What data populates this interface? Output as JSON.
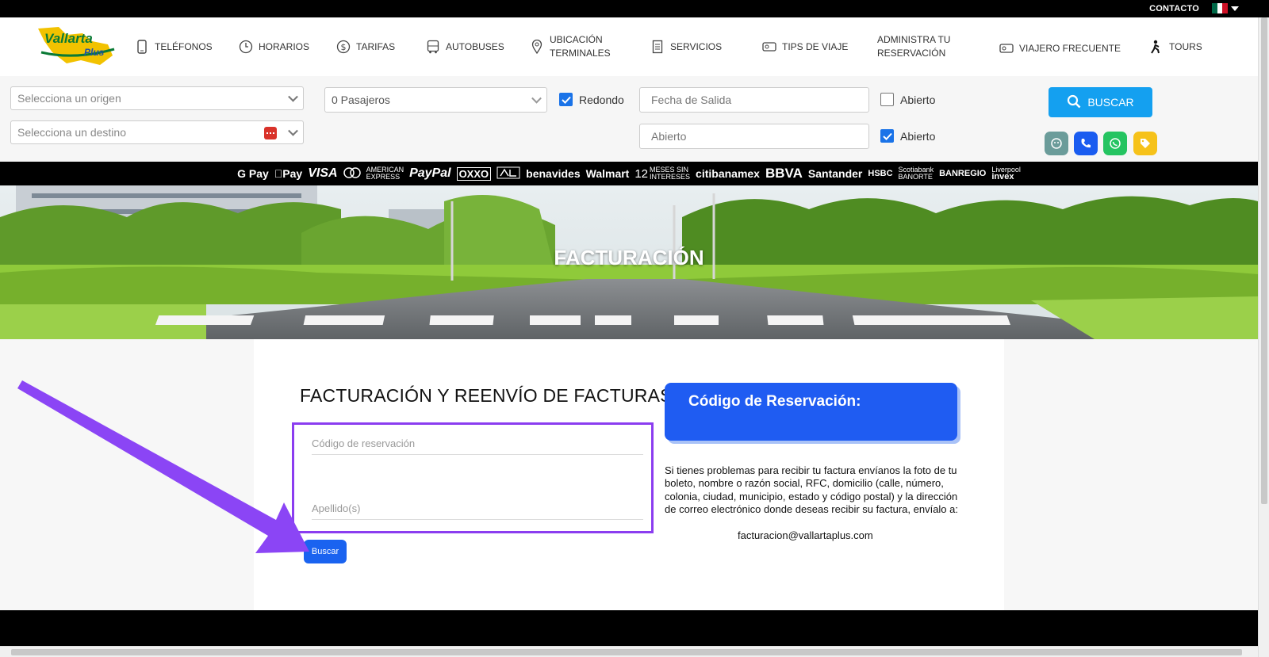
{
  "topbar": {
    "contact": "CONTACTO",
    "flag_colors": [
      "#006847",
      "#ffffff",
      "#ce1126"
    ]
  },
  "brand": {
    "logo_text_1": "Vallarta",
    "logo_text_2": "Plus",
    "logo_yellow": "#f2c200",
    "logo_green": "#0a7a35",
    "logo_blue": "#1e4fa8"
  },
  "nav": {
    "telefonos": "TELÉFONOS",
    "horarios": "HORARIOS",
    "tarifas": "TARIFAS",
    "autobuses": "AUTOBUSES",
    "ubicacion_1": "UBICACIÓN",
    "ubicacion_2": "TERMINALES",
    "servicios": "SERVICIOS",
    "tips": "TIPS DE VIAJE",
    "administra_1": "ADMINISTRA TU",
    "administra_2": "RESERVACIÓN",
    "viajero": "VIAJERO FRECUENTE",
    "tours": "TOURS"
  },
  "search": {
    "origen_placeholder": "Selecciona un origen",
    "destino_placeholder": "Selecciona un destino",
    "pasajeros": "0 Pasajeros",
    "redondo": "Redondo",
    "redondo_checked": true,
    "fecha_salida": "Fecha de Salida",
    "fecha_regreso": "Abierto",
    "abierto_1": "Abierto",
    "abierto_1_checked": false,
    "abierto_2": "Abierto",
    "abierto_2_checked": true,
    "buscar": "BUSCAR",
    "accent": "#14a0f0"
  },
  "quick_buttons": [
    {
      "icon": "chat-bot-icon",
      "color": "#6b9c9a"
    },
    {
      "icon": "phone-icon",
      "color": "#1a5cf0"
    },
    {
      "icon": "whatsapp-icon",
      "color": "#25c461"
    },
    {
      "icon": "tag-icon",
      "color": "#f6c21a"
    }
  ],
  "payments": {
    "gpay": "G Pay",
    "applepay": "Pay",
    "visa": "VISA",
    "amex_1": "AMERICAN",
    "amex_2": "EXPRESS",
    "paypal": "PayPal",
    "oxxo": "OXXO",
    "benavides": "benavides",
    "walmart": "Walmart",
    "meses_num": "12",
    "meses_1": "MESES SIN",
    "meses_2": "INTERESES",
    "citibanamex": "citibanamex",
    "bbva": "BBVA",
    "santander": "Santander",
    "hsbc": "HSBC",
    "scotiabank": "Scotiabank",
    "banorte": "BANORTE",
    "banregio": "BANREGIO",
    "liverpool": "Liverpool",
    "invex": "invex"
  },
  "hero": {
    "title": "FACTURACIÓN"
  },
  "billing": {
    "title": "FACTURACIÓN Y REENVÍO DE FACTURAS",
    "codigo_placeholder": "Código de reservación",
    "apellido_placeholder": "Apellido(s)",
    "buscar": "Buscar",
    "highlight_color": "#8b3df0",
    "card_title": "Código de Reservación:",
    "info_text": "Si tienes problemas para recibir tu factura envíanos la foto de tu boleto, nombre o razón social, RFC, domicilio (calle, número, colonia, ciudad, municipio, estado y código postal) y la dirección de correo electrónico donde deseas recibir su factura, envíalo a:",
    "email": "facturacion@vallartaplus.com"
  }
}
